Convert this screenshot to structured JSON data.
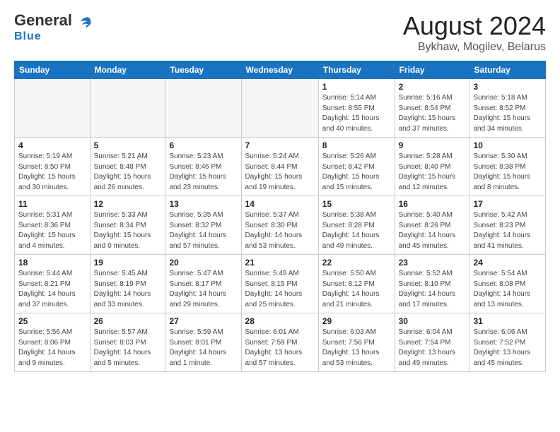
{
  "header": {
    "logo_main": "General",
    "logo_sub": "Blue",
    "month_title": "August 2024",
    "location": "Bykhaw, Mogilev, Belarus"
  },
  "days_of_week": [
    "Sunday",
    "Monday",
    "Tuesday",
    "Wednesday",
    "Thursday",
    "Friday",
    "Saturday"
  ],
  "weeks": [
    [
      {
        "day": "",
        "info": ""
      },
      {
        "day": "",
        "info": ""
      },
      {
        "day": "",
        "info": ""
      },
      {
        "day": "",
        "info": ""
      },
      {
        "day": "1",
        "info": "Sunrise: 5:14 AM\nSunset: 8:55 PM\nDaylight: 15 hours\nand 40 minutes."
      },
      {
        "day": "2",
        "info": "Sunrise: 5:16 AM\nSunset: 8:54 PM\nDaylight: 15 hours\nand 37 minutes."
      },
      {
        "day": "3",
        "info": "Sunrise: 5:18 AM\nSunset: 8:52 PM\nDaylight: 15 hours\nand 34 minutes."
      }
    ],
    [
      {
        "day": "4",
        "info": "Sunrise: 5:19 AM\nSunset: 8:50 PM\nDaylight: 15 hours\nand 30 minutes."
      },
      {
        "day": "5",
        "info": "Sunrise: 5:21 AM\nSunset: 8:48 PM\nDaylight: 15 hours\nand 26 minutes."
      },
      {
        "day": "6",
        "info": "Sunrise: 5:23 AM\nSunset: 8:46 PM\nDaylight: 15 hours\nand 23 minutes."
      },
      {
        "day": "7",
        "info": "Sunrise: 5:24 AM\nSunset: 8:44 PM\nDaylight: 15 hours\nand 19 minutes."
      },
      {
        "day": "8",
        "info": "Sunrise: 5:26 AM\nSunset: 8:42 PM\nDaylight: 15 hours\nand 15 minutes."
      },
      {
        "day": "9",
        "info": "Sunrise: 5:28 AM\nSunset: 8:40 PM\nDaylight: 15 hours\nand 12 minutes."
      },
      {
        "day": "10",
        "info": "Sunrise: 5:30 AM\nSunset: 8:38 PM\nDaylight: 15 hours\nand 8 minutes."
      }
    ],
    [
      {
        "day": "11",
        "info": "Sunrise: 5:31 AM\nSunset: 8:36 PM\nDaylight: 15 hours\nand 4 minutes."
      },
      {
        "day": "12",
        "info": "Sunrise: 5:33 AM\nSunset: 8:34 PM\nDaylight: 15 hours\nand 0 minutes."
      },
      {
        "day": "13",
        "info": "Sunrise: 5:35 AM\nSunset: 8:32 PM\nDaylight: 14 hours\nand 57 minutes."
      },
      {
        "day": "14",
        "info": "Sunrise: 5:37 AM\nSunset: 8:30 PM\nDaylight: 14 hours\nand 53 minutes."
      },
      {
        "day": "15",
        "info": "Sunrise: 5:38 AM\nSunset: 8:28 PM\nDaylight: 14 hours\nand 49 minutes."
      },
      {
        "day": "16",
        "info": "Sunrise: 5:40 AM\nSunset: 8:26 PM\nDaylight: 14 hours\nand 45 minutes."
      },
      {
        "day": "17",
        "info": "Sunrise: 5:42 AM\nSunset: 8:23 PM\nDaylight: 14 hours\nand 41 minutes."
      }
    ],
    [
      {
        "day": "18",
        "info": "Sunrise: 5:44 AM\nSunset: 8:21 PM\nDaylight: 14 hours\nand 37 minutes."
      },
      {
        "day": "19",
        "info": "Sunrise: 5:45 AM\nSunset: 8:19 PM\nDaylight: 14 hours\nand 33 minutes."
      },
      {
        "day": "20",
        "info": "Sunrise: 5:47 AM\nSunset: 8:17 PM\nDaylight: 14 hours\nand 29 minutes."
      },
      {
        "day": "21",
        "info": "Sunrise: 5:49 AM\nSunset: 8:15 PM\nDaylight: 14 hours\nand 25 minutes."
      },
      {
        "day": "22",
        "info": "Sunrise: 5:50 AM\nSunset: 8:12 PM\nDaylight: 14 hours\nand 21 minutes."
      },
      {
        "day": "23",
        "info": "Sunrise: 5:52 AM\nSunset: 8:10 PM\nDaylight: 14 hours\nand 17 minutes."
      },
      {
        "day": "24",
        "info": "Sunrise: 5:54 AM\nSunset: 8:08 PM\nDaylight: 14 hours\nand 13 minutes."
      }
    ],
    [
      {
        "day": "25",
        "info": "Sunrise: 5:56 AM\nSunset: 8:06 PM\nDaylight: 14 hours\nand 9 minutes."
      },
      {
        "day": "26",
        "info": "Sunrise: 5:57 AM\nSunset: 8:03 PM\nDaylight: 14 hours\nand 5 minutes."
      },
      {
        "day": "27",
        "info": "Sunrise: 5:59 AM\nSunset: 8:01 PM\nDaylight: 14 hours\nand 1 minute."
      },
      {
        "day": "28",
        "info": "Sunrise: 6:01 AM\nSunset: 7:59 PM\nDaylight: 13 hours\nand 57 minutes."
      },
      {
        "day": "29",
        "info": "Sunrise: 6:03 AM\nSunset: 7:56 PM\nDaylight: 13 hours\nand 53 minutes."
      },
      {
        "day": "30",
        "info": "Sunrise: 6:04 AM\nSunset: 7:54 PM\nDaylight: 13 hours\nand 49 minutes."
      },
      {
        "day": "31",
        "info": "Sunrise: 6:06 AM\nSunset: 7:52 PM\nDaylight: 13 hours\nand 45 minutes."
      }
    ]
  ]
}
